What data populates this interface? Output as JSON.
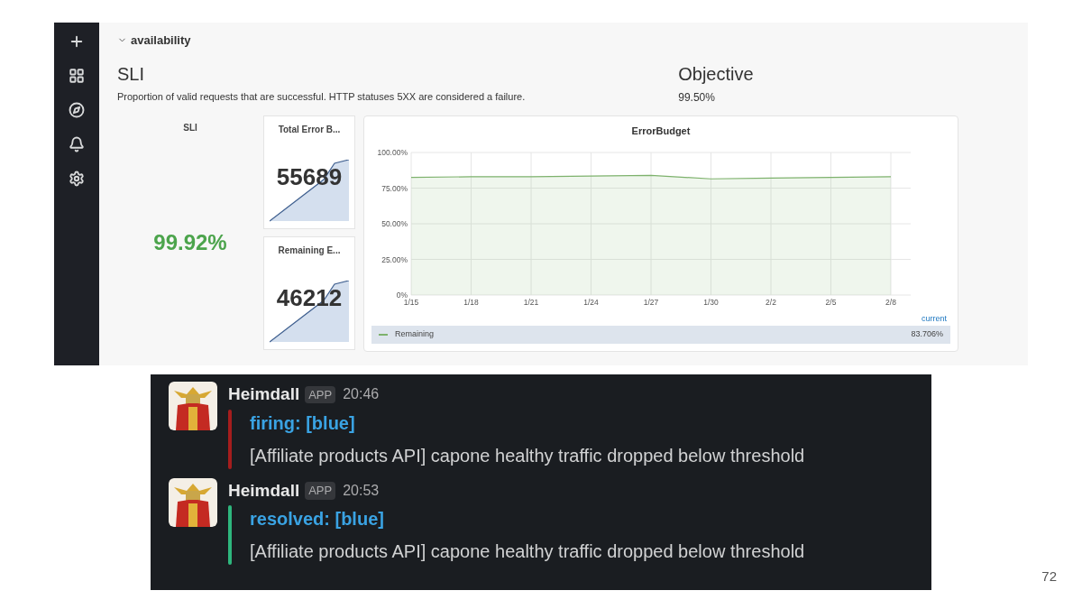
{
  "dashboard": {
    "row": {
      "title": "availability",
      "expanded": true
    },
    "sli": {
      "title": "SLI",
      "description": "Proportion of valid requests that are successful. HTTP statuses 5XX are considered a failure."
    },
    "objective": {
      "title": "Objective",
      "value": "99.50%"
    },
    "sli_stat": {
      "title": "SLI",
      "value": "99.92%"
    },
    "stat_panels": [
      {
        "title": "Total Error B...",
        "value": "55689"
      },
      {
        "title": "Remaining E...",
        "value": "46212"
      }
    ],
    "chart": {
      "chart_data": {
        "type": "area",
        "title": "ErrorBudget",
        "categories": [
          "1/15",
          "1/18",
          "1/21",
          "1/24",
          "1/27",
          "1/30",
          "2/2",
          "2/5",
          "2/8"
        ],
        "series": [
          {
            "name": "Remaining",
            "color": "#7eb26d",
            "values": [
              82.5,
              83,
              83,
              83.5,
              84,
              81.5,
              82,
              82.5,
              83
            ]
          }
        ],
        "ylim": [
          0,
          100
        ],
        "grid": true,
        "yticks": [
          {
            "value": 0,
            "label": "0%"
          },
          {
            "value": 25,
            "label": "25.00%"
          },
          {
            "value": 50,
            "label": "50.00%"
          },
          {
            "value": 75,
            "label": "75.00%"
          },
          {
            "value": 100,
            "label": "100.00%"
          }
        ]
      },
      "legend": {
        "header": "current",
        "values": [
          "83.706%"
        ]
      }
    }
  },
  "chat": {
    "messages": [
      {
        "sender": "Heimdall",
        "badge": "APP",
        "time": "20:46",
        "status": "firing: [blue]",
        "text": "[Affiliate products API] capone healthy traffic dropped below threshold",
        "color": "#a51d1d"
      },
      {
        "sender": "Heimdall",
        "badge": "APP",
        "time": "20:53",
        "status": "resolved: [blue]",
        "text": "[Affiliate products API] capone healthy traffic dropped below threshold",
        "color": "#2eb67d"
      }
    ]
  },
  "page_number": "72"
}
